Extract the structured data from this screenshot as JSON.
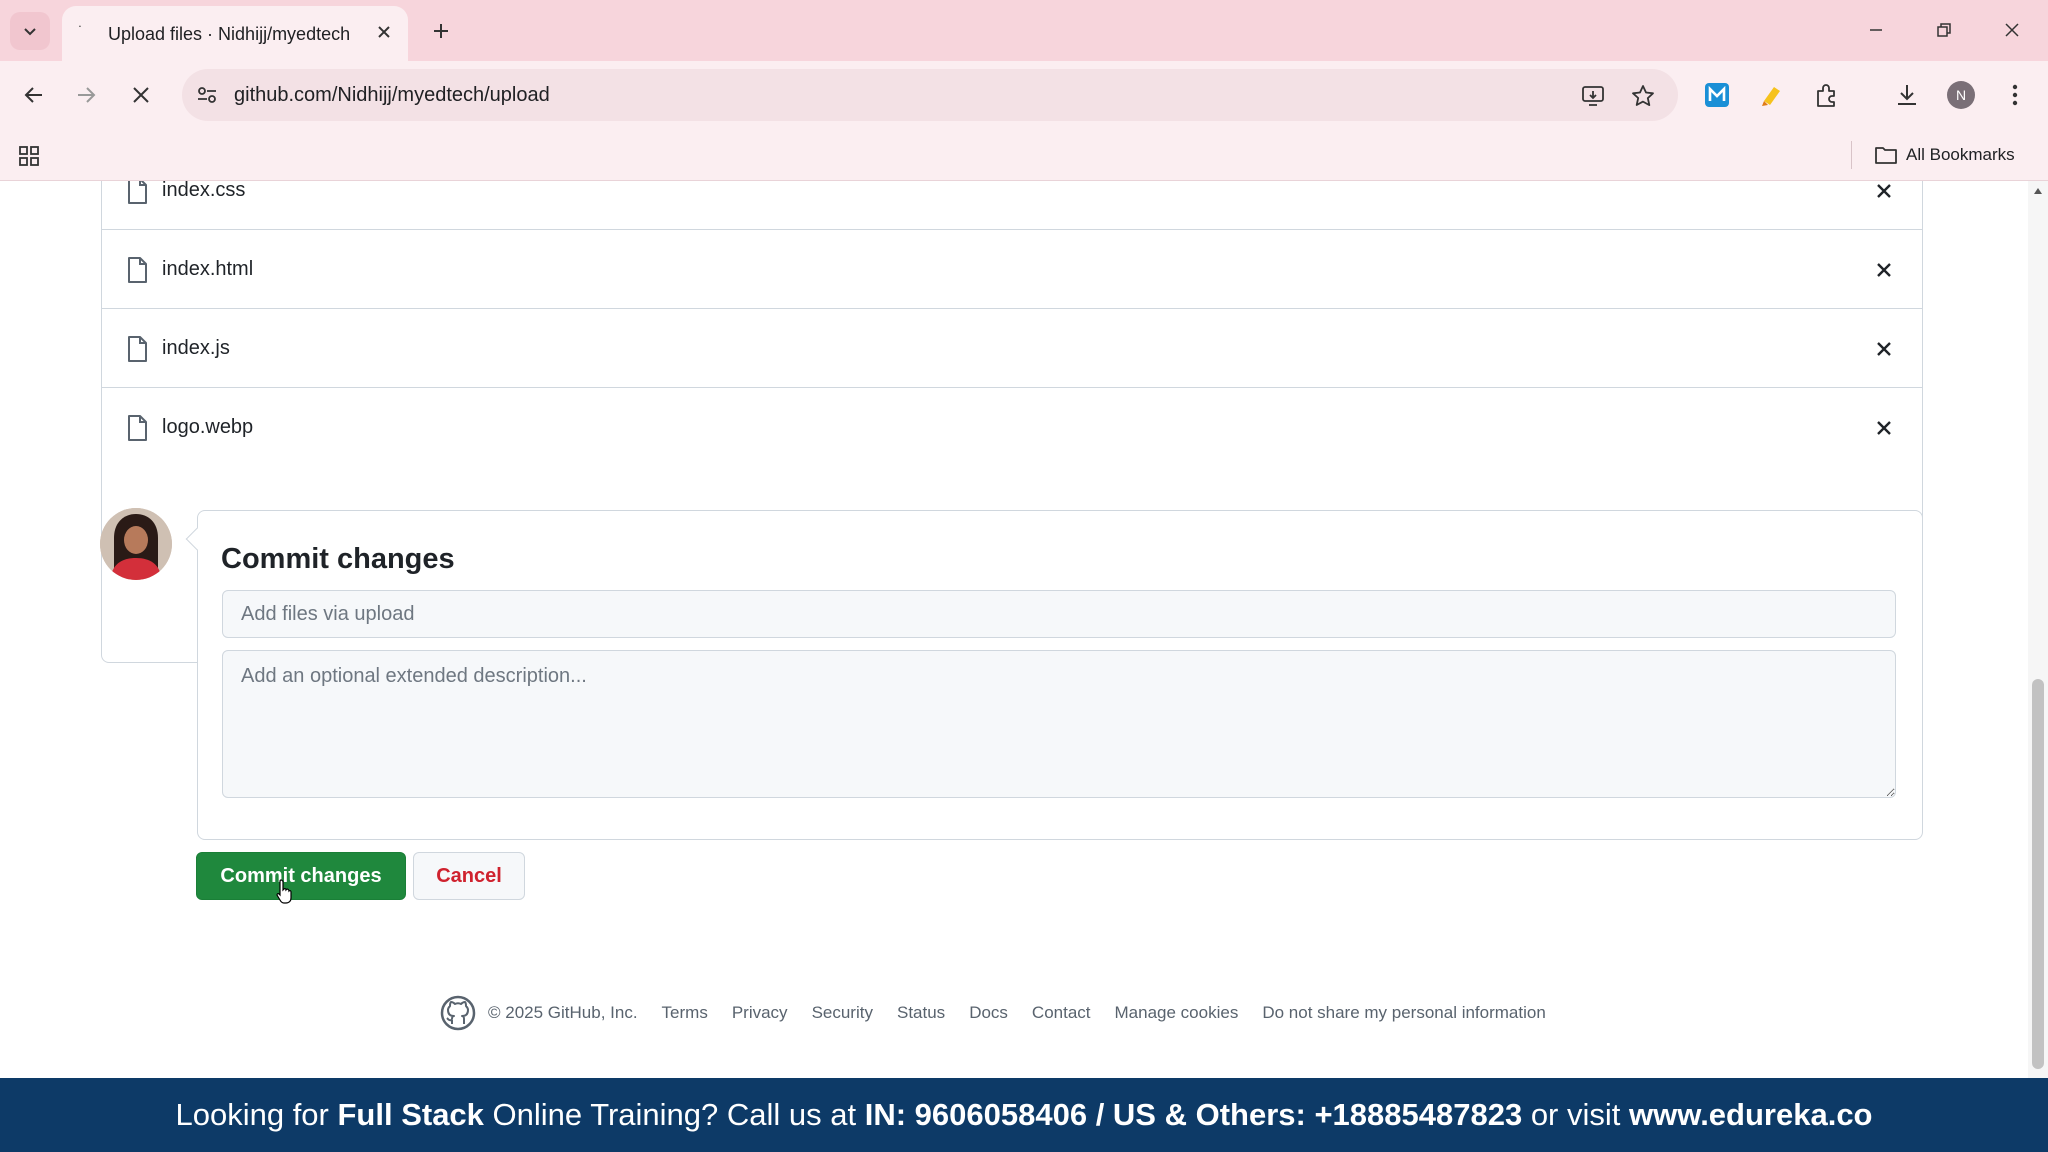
{
  "browser": {
    "tab_title": "Upload files · Nidhijj/myedtech",
    "url": "github.com/Nidhijj/myedtech/upload",
    "bookmarks_label": "All Bookmarks",
    "profile_initial": "N"
  },
  "files": [
    {
      "name": "index.css"
    },
    {
      "name": "index.html"
    },
    {
      "name": "index.js"
    },
    {
      "name": "logo.webp"
    }
  ],
  "commit": {
    "title": "Commit changes",
    "summary_placeholder": "Add files via upload",
    "description_placeholder": "Add an optional extended description...",
    "commit_button": "Commit changes",
    "cancel_button": "Cancel"
  },
  "footer": {
    "copyright": "© 2025 GitHub, Inc.",
    "links": [
      "Terms",
      "Privacy",
      "Security",
      "Status",
      "Docs",
      "Contact",
      "Manage cookies",
      "Do not share my personal information"
    ]
  },
  "banner": {
    "part1": "Looking for ",
    "bold1": "Full Stack",
    "part2": " Online Training? Call us at ",
    "bold2": "IN: 9606058406 / US & Others: +18885487823",
    "part3": " or visit ",
    "bold3": "www.edureka.co"
  },
  "colors": {
    "tabbar": "#f7d5dc",
    "primary_button": "#1f883d",
    "cancel_text": "#cf222e",
    "banner": "#0d3a67"
  }
}
